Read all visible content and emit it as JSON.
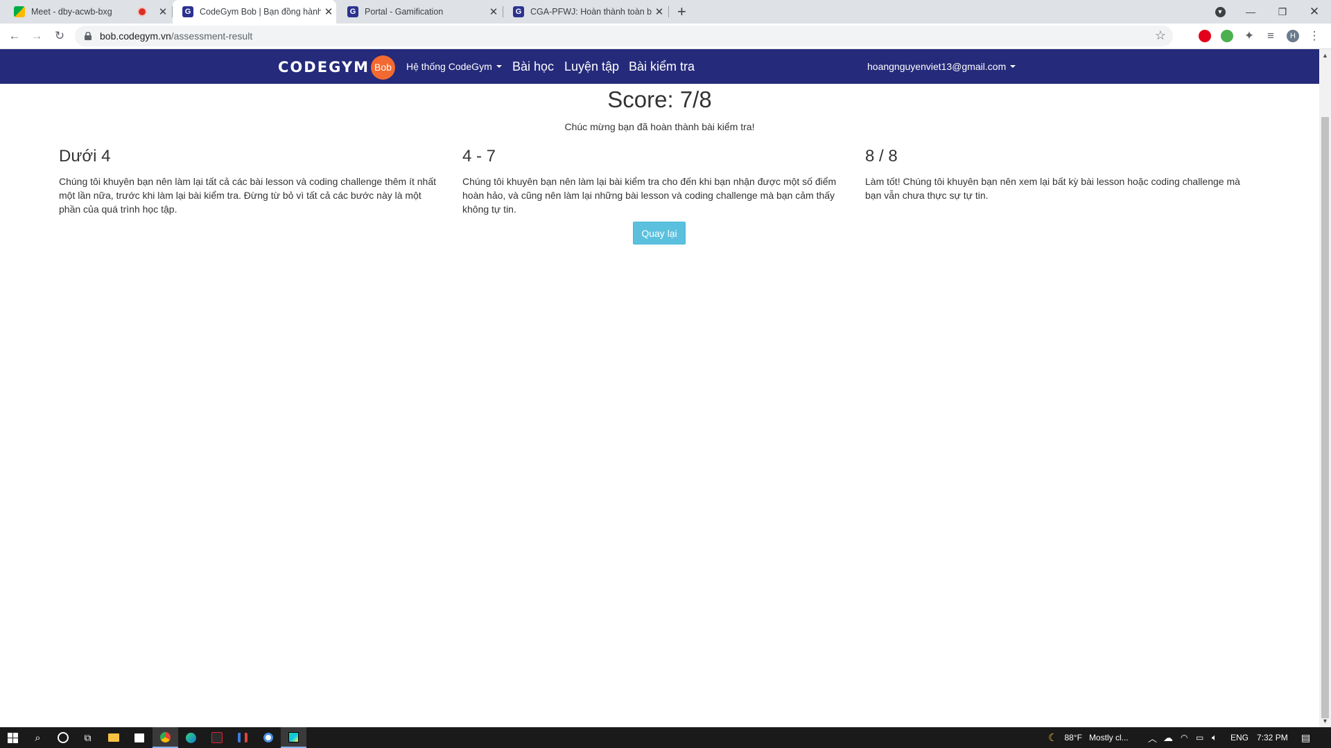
{
  "browser": {
    "tabs": [
      {
        "title": "Meet - dby-acwb-bxg",
        "favicon": "google-meet-icon",
        "recording": true
      },
      {
        "title": "CodeGym Bob | Bạn đồng hành c",
        "favicon": "codegym-icon",
        "active": true
      },
      {
        "title": "Portal - Gamification",
        "favicon": "codegym-icon"
      },
      {
        "title": "CGA-PFWJ: Hoàn thành toàn bộ",
        "favicon": "codegym-icon"
      }
    ],
    "url_host": "bob.codegym.vn",
    "url_path": "/assessment-result",
    "profile_initial": "H"
  },
  "navbar": {
    "logo_text": "CODEGYM",
    "logo_badge": "Bob",
    "menu": [
      {
        "label": "Hệ thống CodeGym",
        "dropdown": true
      },
      {
        "label": "Bài học"
      },
      {
        "label": "Luyện tập"
      },
      {
        "label": "Bài kiểm tra"
      }
    ],
    "user_email": "hoangnguyenviet13@gmail.com",
    "background": "#252a7a"
  },
  "result": {
    "score": "Score: 7/8",
    "message": "Chúc mừng bạn đã hoàn thành bài kiểm tra!",
    "ranges": [
      {
        "heading": "Dưới 4",
        "text": "Chúng tôi khuyên bạn nên làm lại tất cả các bài lesson và coding challenge thêm ít nhất một lần nữa, trước khi làm lại bài kiểm tra. Đừng từ bỏ vì tất cả các bước này là một phần của quá trình học tập."
      },
      {
        "heading": "4 - 7",
        "text": "Chúng tôi khuyên bạn nên làm lại bài kiểm tra cho đến khi bạn nhận được một số điểm hoàn hảo, và cũng nên làm lại những bài lesson và coding challenge mà bạn cảm thấy không tự tin."
      },
      {
        "heading": "8 / 8",
        "text": "Làm tốt! Chúng tôi khuyên bạn nên xem lại bất kỳ bài lesson hoặc coding challenge mà bạn vẫn chưa thực sự tự tin."
      }
    ],
    "back_button": "Quay lại",
    "button_color": "#5bc0de"
  },
  "taskbar": {
    "weather_temp": "88°F",
    "weather_text": "Mostly cl...",
    "language": "ENG",
    "time": "7:32 PM"
  }
}
